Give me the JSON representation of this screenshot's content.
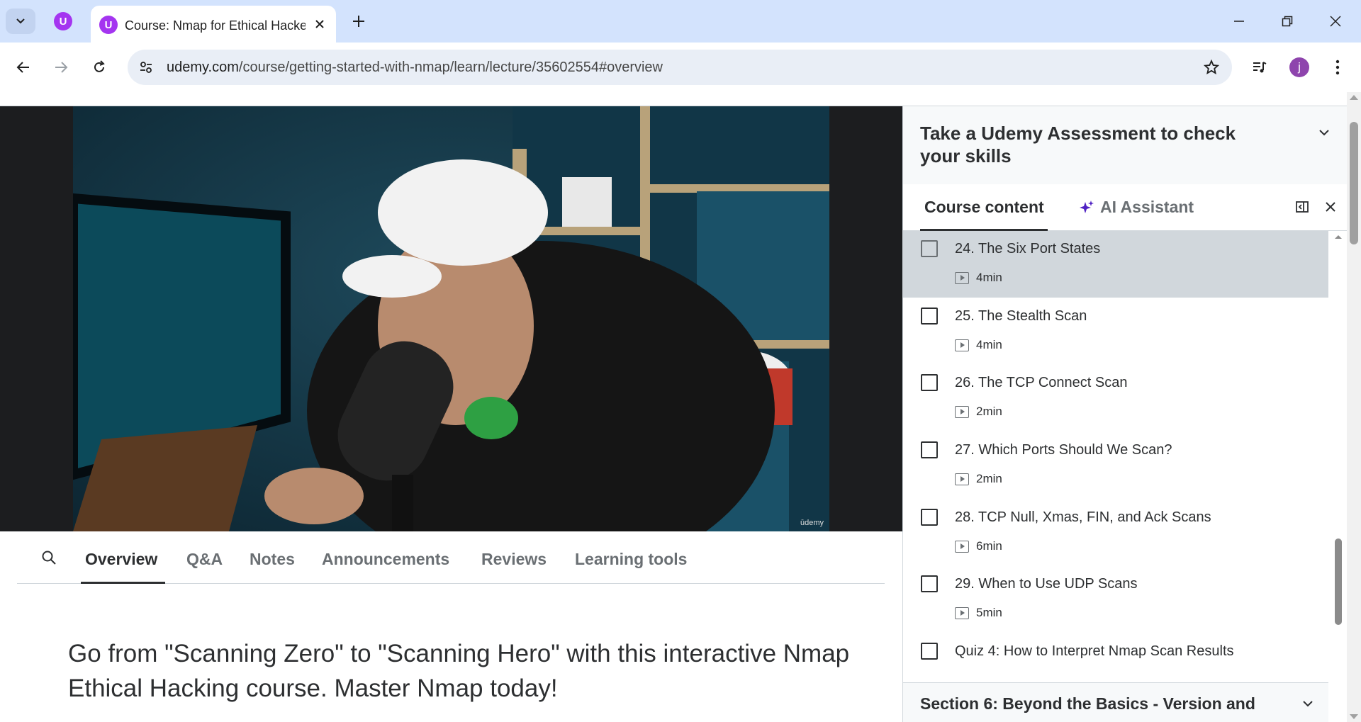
{
  "browser": {
    "tab_title": "Course: Nmap for Ethical Hacke",
    "url_domain": "udemy.com",
    "url_path": "/course/getting-started-with-nmap/learn/lecture/35602554#overview",
    "profile_initial": "j",
    "favicon_letter": "U"
  },
  "video": {
    "watermark": "ūdemy"
  },
  "lecture_tabs": [
    "Overview",
    "Q&A",
    "Notes",
    "Announcements",
    "Reviews",
    "Learning tools"
  ],
  "overview": {
    "headline": "Go from \"Scanning Zero\" to \"Scanning Hero\" with this interactive Nmap Ethical Hacking course. Master Nmap today!"
  },
  "sidebar": {
    "assessment_text": "Take a Udemy Assessment to check your skills",
    "tab_course_content": "Course content",
    "tab_ai_assistant": "AI Assistant",
    "lectures": [
      {
        "title": "24. The Six Port States",
        "duration": "4min",
        "current": true
      },
      {
        "title": "25. The Stealth Scan",
        "duration": "4min"
      },
      {
        "title": "26. The TCP Connect Scan",
        "duration": "2min"
      },
      {
        "title": "27. Which Ports Should We Scan?",
        "duration": "2min"
      },
      {
        "title": "28. TCP Null, Xmas, FIN, and Ack Scans",
        "duration": "6min"
      },
      {
        "title": "29. When to Use UDP Scans",
        "duration": "5min"
      },
      {
        "title": "Quiz 4: How to Interpret Nmap Scan Results",
        "duration": ""
      }
    ],
    "next_section": "Section 6: Beyond the Basics - Version and"
  },
  "colors": {
    "browser_bar": "#d3e3fd",
    "udemy_purple": "#a435f0",
    "current_lecture_bg": "#d1d7dc",
    "text_dark": "#2d2f31"
  }
}
